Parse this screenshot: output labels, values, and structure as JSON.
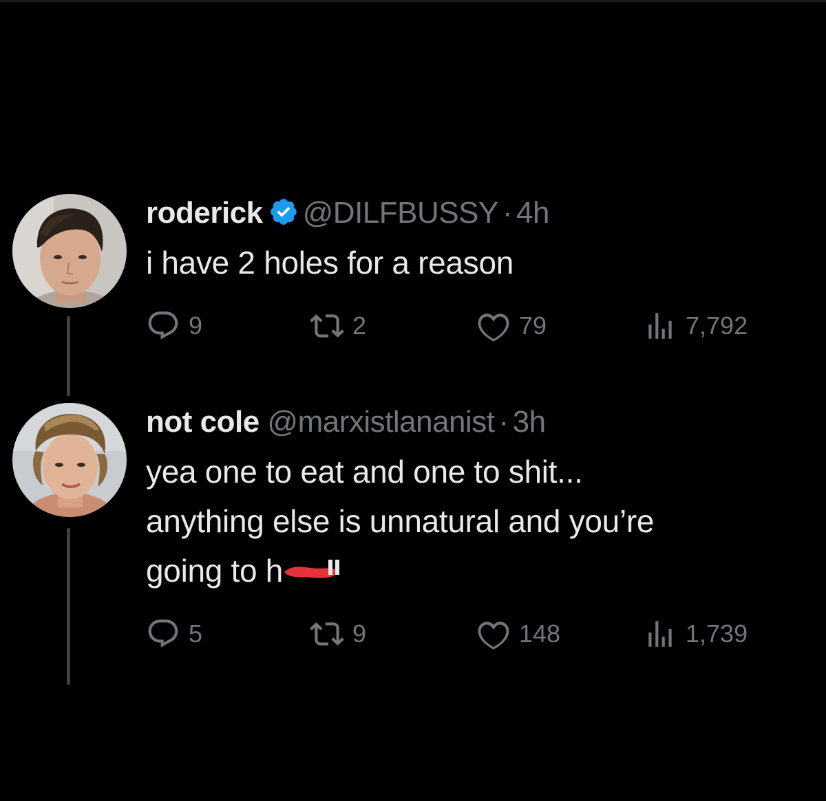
{
  "tweets": [
    {
      "display_name": "roderick",
      "verified": true,
      "handle": "@DILFBUSSY",
      "separator": "·",
      "time": "4h",
      "lines": [
        "i have 2 holes for a reason"
      ],
      "replies": "9",
      "retweets": "2",
      "likes": "79",
      "views": "7,792"
    },
    {
      "display_name": "not cole",
      "verified": false,
      "handle": "@marxistlananist",
      "separator": "·",
      "time": "3h",
      "lines": [
        "yea one to eat and one to shit...",
        "anything else is unnatural and you’re",
        "going to h"
      ],
      "redacted_tail": "ell",
      "replies": "5",
      "retweets": "9",
      "likes": "148",
      "views": "1,739"
    }
  ],
  "icons": {
    "reply": "reply-icon",
    "retweet": "retweet-icon",
    "like": "heart-icon",
    "views": "views-icon",
    "verified": "verified-badge-icon"
  },
  "colors": {
    "background": "#000000",
    "primary_text": "#e7e9ea",
    "secondary_text": "#71767b",
    "verified_blue": "#1d9bf0",
    "thread_line": "#3e4144",
    "redaction": "#e8323a"
  }
}
